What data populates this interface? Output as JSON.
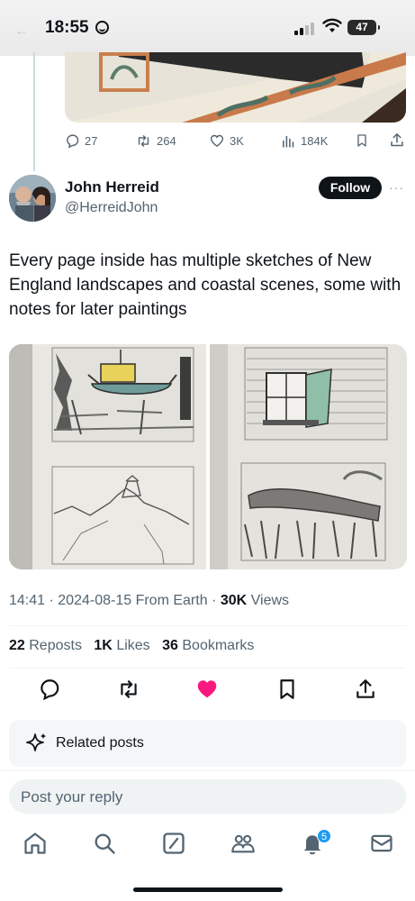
{
  "status_bar": {
    "time": "18:55",
    "battery": "47"
  },
  "previous_post": {
    "actions": {
      "replies": "27",
      "reposts": "264",
      "likes": "3K",
      "views": "184K"
    }
  },
  "author": {
    "name": "John Herreid",
    "handle": "@HerreidJohn",
    "follow_label": "Follow"
  },
  "tweet": {
    "text": "Every page inside has multiple sketches of New England landscapes and coastal scenes, some with notes for later paintings",
    "time": "14:41",
    "date": "2024-08-15",
    "source": "From Earth",
    "views_count": "30K",
    "views_label": "Views"
  },
  "stats": {
    "reposts_count": "22",
    "reposts_label": "Reposts",
    "likes_count": "1K",
    "likes_label": "Likes",
    "bookmarks_count": "36",
    "bookmarks_label": "Bookmarks"
  },
  "related": {
    "label": "Related posts"
  },
  "reply": {
    "placeholder": "Post your reply"
  },
  "nav": {
    "notifications_badge": "5"
  },
  "colors": {
    "accent": "#1d9bf0",
    "like": "#f91880",
    "text": "#0f1419",
    "muted": "#536471"
  }
}
